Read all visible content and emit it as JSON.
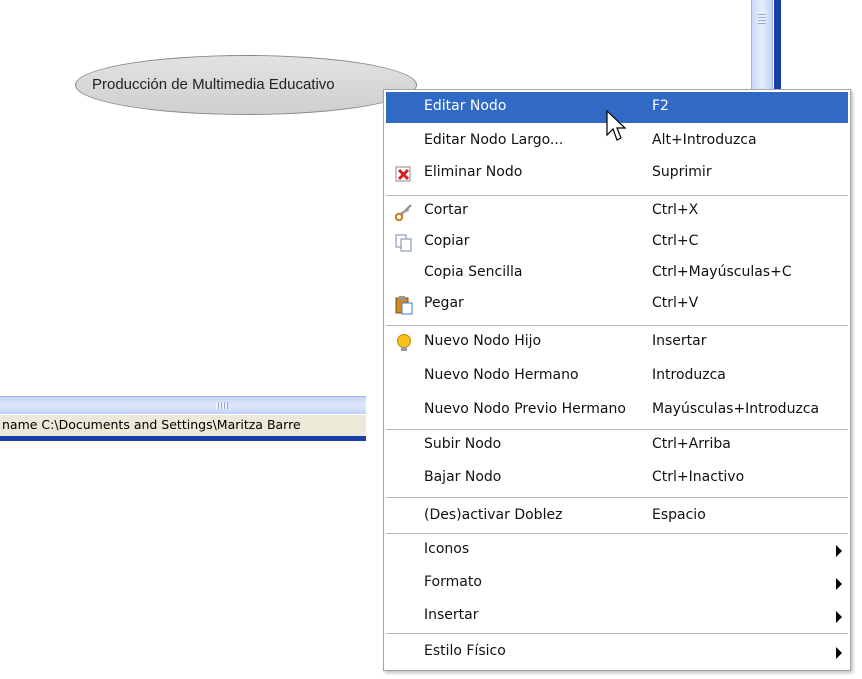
{
  "canvas": {
    "node_text": "Producción de Multimedia Educativo",
    "status_text": "name C:\\Documents and Settings\\Maritza Barre"
  },
  "menu": {
    "highlight_color": "#316ac5",
    "items": [
      {
        "label": "Editar Nodo",
        "shortcut": "F2",
        "highlighted": true
      },
      {
        "label": "Editar Nodo Largo...",
        "shortcut": "Alt+Introduzca"
      },
      {
        "label": "Eliminar Nodo",
        "shortcut": "Suprimir",
        "icon": "delete-x-icon"
      },
      {
        "label": "Cortar",
        "shortcut": "Ctrl+X",
        "icon": "scissors-icon"
      },
      {
        "label": "Copiar",
        "shortcut": "Ctrl+C",
        "icon": "copy-icon"
      },
      {
        "label": "Copia Sencilla",
        "shortcut": "Ctrl+Mayúsculas+C"
      },
      {
        "label": "Pegar",
        "shortcut": "Ctrl+V",
        "icon": "paste-clipboard-icon"
      },
      {
        "label": "Nuevo Nodo Hijo",
        "shortcut": "Insertar",
        "icon": "lightbulb-icon"
      },
      {
        "label": "Nuevo Nodo Hermano",
        "shortcut": "Introduzca"
      },
      {
        "label": "Nuevo Nodo Previo Hermano",
        "shortcut": "Mayúsculas+Introduzca"
      },
      {
        "label": "Subir Nodo",
        "shortcut": "Ctrl+Arriba"
      },
      {
        "label": "Bajar Nodo",
        "shortcut": "Ctrl+Inactivo"
      },
      {
        "label": "(Des)activar Doblez",
        "shortcut": "Espacio"
      },
      {
        "label": "Iconos",
        "submenu": true
      },
      {
        "label": "Formato",
        "submenu": true
      },
      {
        "label": "Insertar",
        "submenu": true
      },
      {
        "label": "Estilo Físico",
        "submenu": true
      }
    ]
  }
}
